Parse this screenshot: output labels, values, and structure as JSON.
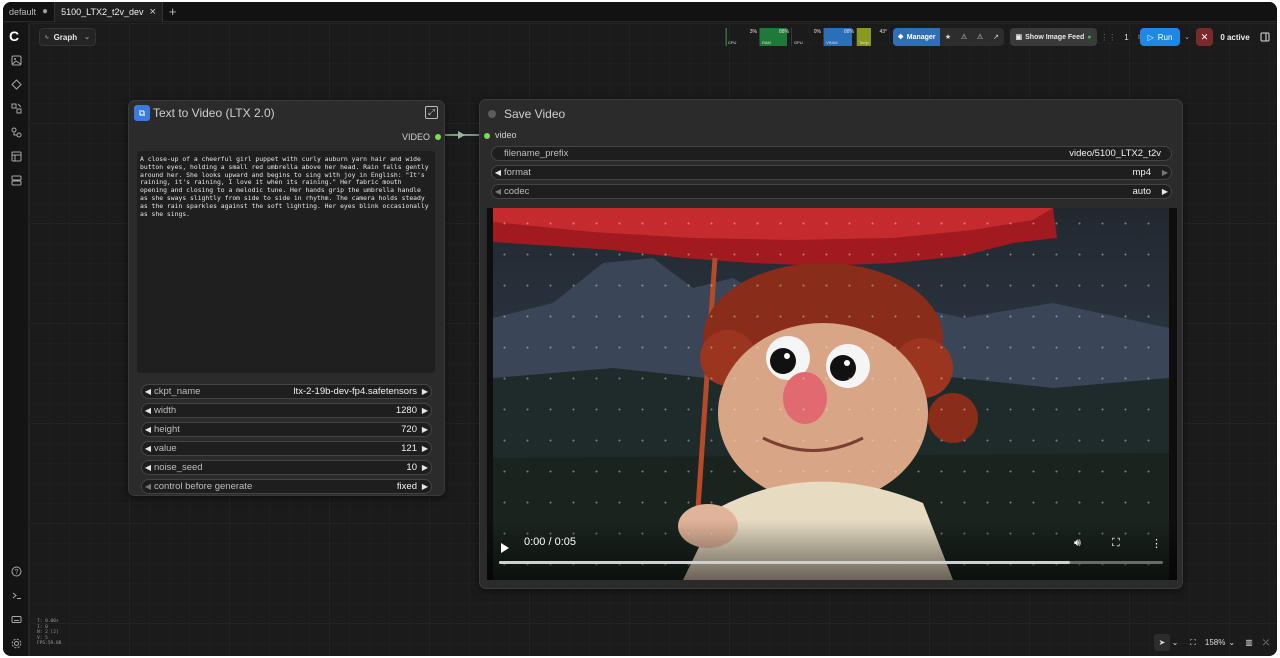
{
  "tabs": [
    {
      "label": "default",
      "close": "●"
    },
    {
      "label": "5100_LTX2_t2v_dev",
      "close": "×"
    }
  ],
  "tab_add": "+",
  "graph_button": {
    "label": "Graph"
  },
  "resources": [
    {
      "label": "CPU",
      "pct": "3%",
      "level": 0.03,
      "color": "#1f7a3a"
    },
    {
      "label": "RAM",
      "pct": "88%",
      "level": 0.88,
      "color": "#1f7a3a"
    },
    {
      "label": "GPU",
      "pct": "0%",
      "level": 0.0,
      "color": "#1f7a3a"
    },
    {
      "label": "VRAM",
      "pct": "88%",
      "level": 0.88,
      "color": "#2a6fb8"
    },
    {
      "label": "Temp",
      "pct": "43°",
      "level": 0.43,
      "color": "#8a9a20"
    }
  ],
  "toolbar": {
    "manager_label": "Manager",
    "show_feed_label": "Show Image Feed",
    "queue_count": "1",
    "run_label": "Run",
    "active_label": "0 active",
    "cancel_icon": "✕"
  },
  "node_t2v": {
    "title": "Text to Video (LTX 2.0)",
    "output_label": "VIDEO",
    "prompt": "A close-up of a cheerful girl puppet with curly auburn yarn hair and wide button eyes, holding a small red umbrella above her head. Rain falls gently around her. She looks upward and begins to sing with joy in English: \"It's raining, it's raining, I love it when its raining.\" Her fabric mouth opening and closing to a melodic tune. Her hands grip the umbrella handle as she sways slightly from side to side in rhythm. The camera holds steady as the rain sparkles against the soft lighting. Her eyes blink occasionally as she sings.",
    "widgets": [
      {
        "name": "ckpt_name",
        "value": "ltx-2-19b-dev-fp4.safetensors"
      },
      {
        "name": "width",
        "value": "1280"
      },
      {
        "name": "height",
        "value": "720"
      },
      {
        "name": "value",
        "value": "121"
      },
      {
        "name": "noise_seed",
        "value": "10"
      },
      {
        "name": "control before generate",
        "value": "fixed"
      }
    ]
  },
  "node_save": {
    "title": "Save Video",
    "input_label": "video",
    "widgets": [
      {
        "name": "filename_prefix",
        "value": "video/5100_LTX2_t2v"
      },
      {
        "name": "format",
        "value": "mp4"
      },
      {
        "name": "codec",
        "value": "auto"
      }
    ],
    "player": {
      "time": "0:00 / 0:05",
      "progress": 0.86
    }
  },
  "stats_lines": [
    "T: 0.00s",
    "I: 0",
    "N: 2 [2]",
    "V: 5",
    "FPS:59.88"
  ],
  "zoom": "158%"
}
